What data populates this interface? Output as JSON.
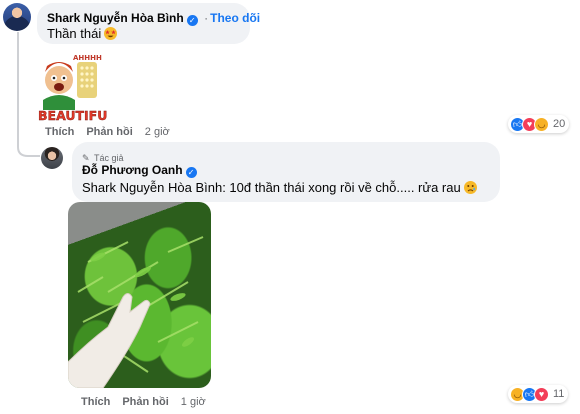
{
  "comment1": {
    "author": "Shark Nguyễn Hòa Bình",
    "follow_label": "Theo dõi",
    "text": "Thần thái",
    "sticker_text_top": "AHHHH",
    "sticker_text_bottom": "BEAUTIFUL!",
    "actions": {
      "like": "Thích",
      "reply": "Phản hồi",
      "time": "2 giờ"
    },
    "reaction_count": "20"
  },
  "reply1": {
    "author_badge": "Tác giả",
    "author": "Đỗ Phương Oanh",
    "mention": "Shark Nguyễn Hòa Bình",
    "text": ": 10đ thần thái xong rồi về chỗ..... rửa rau",
    "actions": {
      "like": "Thích",
      "reply": "Phản hồi",
      "time": "1 giờ"
    },
    "reaction_count": "11"
  },
  "colors": {
    "accent": "#1877f2",
    "bubble": "#f0f2f5",
    "meta": "#65676b"
  },
  "icons": [
    "verified-badge-icon",
    "star-struck-emoji-icon",
    "sad-emoji-icon",
    "like-reaction-icon",
    "love-reaction-icon",
    "haha-reaction-icon"
  ]
}
